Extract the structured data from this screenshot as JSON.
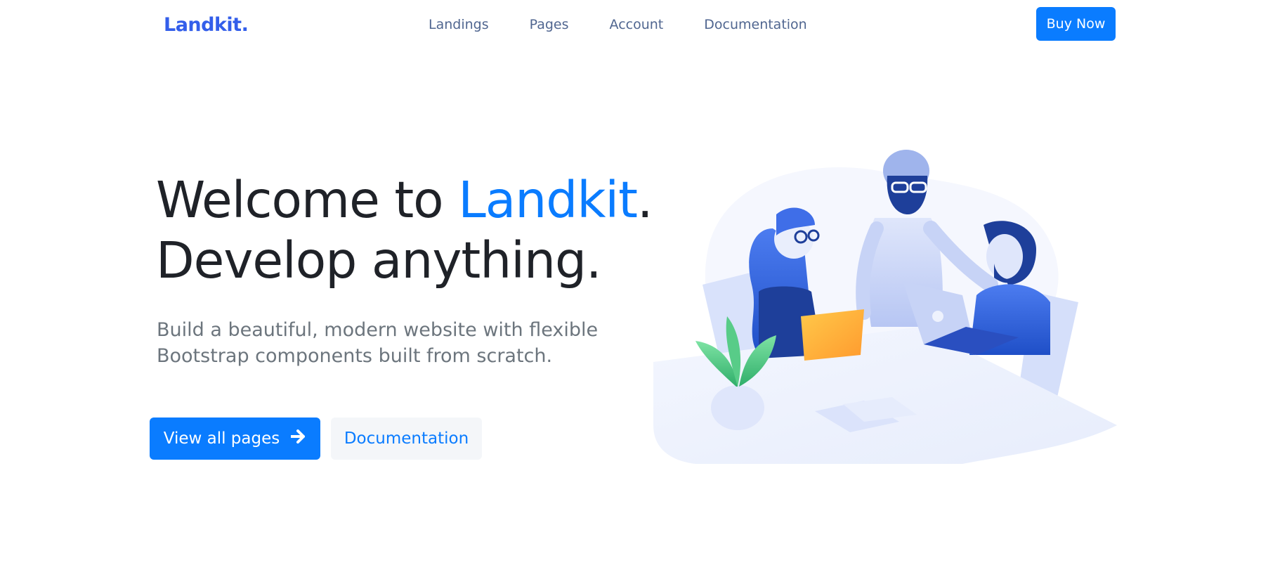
{
  "navbar": {
    "brand": "Landkit.",
    "links": [
      "Landings",
      "Pages",
      "Account",
      "Documentation"
    ],
    "cta": "Buy Now"
  },
  "hero": {
    "title_prefix": "Welcome to ",
    "title_accent": "Landkit",
    "title_suffix": ".",
    "title_line2": "Develop anything.",
    "lead": "Build a beautiful, modern website with flexible Bootstrap components built from scratch.",
    "primary_button": "View all pages",
    "primary_button_icon": "arrow-right-icon",
    "secondary_button": "Documentation"
  },
  "colors": {
    "brand": "#335eea",
    "primary": "#0a7cff",
    "heading": "#1f2228",
    "muted": "#6c757d",
    "nav": "#506690"
  },
  "illustration": {
    "icon": "team-collaboration-illustration"
  }
}
